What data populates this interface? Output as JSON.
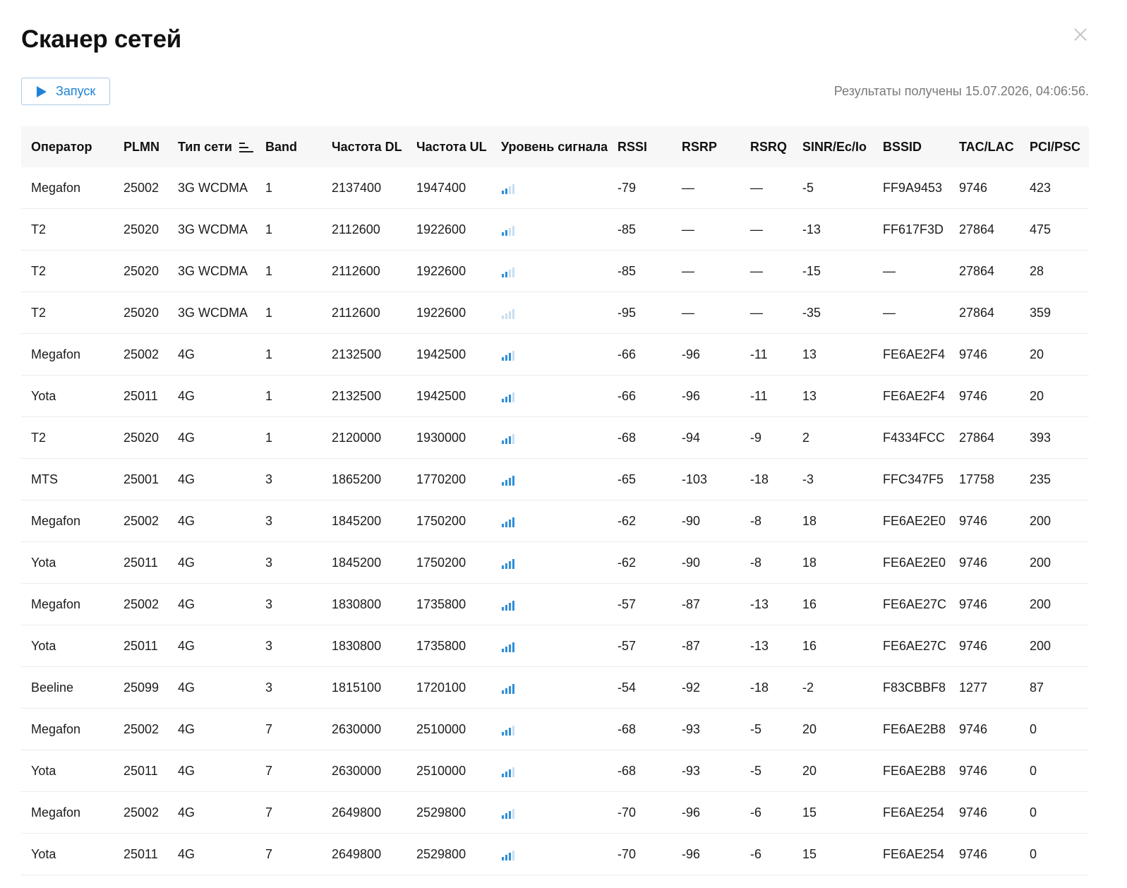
{
  "title": "Сканер сетей",
  "close_icon": "close-icon",
  "run_button": {
    "label": "Запуск",
    "icon": "play-icon"
  },
  "results_time": "Результаты получены 15.07.2026, 04:06:56.",
  "colors": {
    "accent": "#1f84d6",
    "signal_on": "#2f8fd8",
    "signal_off": "#c7def2",
    "border": "#ececec",
    "header_bg": "#f7f7f7"
  },
  "table": {
    "sort_icon": "sort-descending-icon",
    "columns": [
      "Оператор",
      "PLMN",
      "Тип сети",
      "Band",
      "Частота DL",
      "Частота UL",
      "Уровень сигнала",
      "RSSI",
      "RSRP",
      "RSRQ",
      "SINR/Ec/Io",
      "BSSID",
      "TAC/LAC",
      "PCI/PSC"
    ],
    "rows": [
      {
        "operator": "Megafon",
        "plmn": "25002",
        "type": "3G WCDMA",
        "band": "1",
        "dl": "2137400",
        "ul": "1947400",
        "signal": 2,
        "rssi": "-79",
        "rsrp": "—",
        "rsrq": "—",
        "sinr": "-5",
        "bssid": "FF9A9453",
        "tac": "9746",
        "pci": "423"
      },
      {
        "operator": "T2",
        "plmn": "25020",
        "type": "3G WCDMA",
        "band": "1",
        "dl": "2112600",
        "ul": "1922600",
        "signal": 2,
        "rssi": "-85",
        "rsrp": "—",
        "rsrq": "—",
        "sinr": "-13",
        "bssid": "FF617F3D",
        "tac": "27864",
        "pci": "475"
      },
      {
        "operator": "T2",
        "plmn": "25020",
        "type": "3G WCDMA",
        "band": "1",
        "dl": "2112600",
        "ul": "1922600",
        "signal": 2,
        "rssi": "-85",
        "rsrp": "—",
        "rsrq": "—",
        "sinr": "-15",
        "bssid": "—",
        "tac": "27864",
        "pci": "28"
      },
      {
        "operator": "T2",
        "plmn": "25020",
        "type": "3G WCDMA",
        "band": "1",
        "dl": "2112600",
        "ul": "1922600",
        "signal": 0,
        "rssi": "-95",
        "rsrp": "—",
        "rsrq": "—",
        "sinr": "-35",
        "bssid": "—",
        "tac": "27864",
        "pci": "359"
      },
      {
        "operator": "Megafon",
        "plmn": "25002",
        "type": "4G",
        "band": "1",
        "dl": "2132500",
        "ul": "1942500",
        "signal": 3,
        "rssi": "-66",
        "rsrp": "-96",
        "rsrq": "-11",
        "sinr": "13",
        "bssid": "FE6AE2F4",
        "tac": "9746",
        "pci": "20"
      },
      {
        "operator": "Yota",
        "plmn": "25011",
        "type": "4G",
        "band": "1",
        "dl": "2132500",
        "ul": "1942500",
        "signal": 3,
        "rssi": "-66",
        "rsrp": "-96",
        "rsrq": "-11",
        "sinr": "13",
        "bssid": "FE6AE2F4",
        "tac": "9746",
        "pci": "20"
      },
      {
        "operator": "T2",
        "plmn": "25020",
        "type": "4G",
        "band": "1",
        "dl": "2120000",
        "ul": "1930000",
        "signal": 3,
        "rssi": "-68",
        "rsrp": "-94",
        "rsrq": "-9",
        "sinr": "2",
        "bssid": "F4334FCC",
        "tac": "27864",
        "pci": "393"
      },
      {
        "operator": "MTS",
        "plmn": "25001",
        "type": "4G",
        "band": "3",
        "dl": "1865200",
        "ul": "1770200",
        "signal": 4,
        "rssi": "-65",
        "rsrp": "-103",
        "rsrq": "-18",
        "sinr": "-3",
        "bssid": "FFC347F5",
        "tac": "17758",
        "pci": "235"
      },
      {
        "operator": "Megafon",
        "plmn": "25002",
        "type": "4G",
        "band": "3",
        "dl": "1845200",
        "ul": "1750200",
        "signal": 4,
        "rssi": "-62",
        "rsrp": "-90",
        "rsrq": "-8",
        "sinr": "18",
        "bssid": "FE6AE2E0",
        "tac": "9746",
        "pci": "200"
      },
      {
        "operator": "Yota",
        "plmn": "25011",
        "type": "4G",
        "band": "3",
        "dl": "1845200",
        "ul": "1750200",
        "signal": 4,
        "rssi": "-62",
        "rsrp": "-90",
        "rsrq": "-8",
        "sinr": "18",
        "bssid": "FE6AE2E0",
        "tac": "9746",
        "pci": "200"
      },
      {
        "operator": "Megafon",
        "plmn": "25002",
        "type": "4G",
        "band": "3",
        "dl": "1830800",
        "ul": "1735800",
        "signal": 4,
        "rssi": "-57",
        "rsrp": "-87",
        "rsrq": "-13",
        "sinr": "16",
        "bssid": "FE6AE27C",
        "tac": "9746",
        "pci": "200"
      },
      {
        "operator": "Yota",
        "plmn": "25011",
        "type": "4G",
        "band": "3",
        "dl": "1830800",
        "ul": "1735800",
        "signal": 4,
        "rssi": "-57",
        "rsrp": "-87",
        "rsrq": "-13",
        "sinr": "16",
        "bssid": "FE6AE27C",
        "tac": "9746",
        "pci": "200"
      },
      {
        "operator": "Beeline",
        "plmn": "25099",
        "type": "4G",
        "band": "3",
        "dl": "1815100",
        "ul": "1720100",
        "signal": 4,
        "rssi": "-54",
        "rsrp": "-92",
        "rsrq": "-18",
        "sinr": "-2",
        "bssid": "F83CBBF8",
        "tac": "1277",
        "pci": "87"
      },
      {
        "operator": "Megafon",
        "plmn": "25002",
        "type": "4G",
        "band": "7",
        "dl": "2630000",
        "ul": "2510000",
        "signal": 3,
        "rssi": "-68",
        "rsrp": "-93",
        "rsrq": "-5",
        "sinr": "20",
        "bssid": "FE6AE2B8",
        "tac": "9746",
        "pci": "0"
      },
      {
        "operator": "Yota",
        "plmn": "25011",
        "type": "4G",
        "band": "7",
        "dl": "2630000",
        "ul": "2510000",
        "signal": 3,
        "rssi": "-68",
        "rsrp": "-93",
        "rsrq": "-5",
        "sinr": "20",
        "bssid": "FE6AE2B8",
        "tac": "9746",
        "pci": "0"
      },
      {
        "operator": "Megafon",
        "plmn": "25002",
        "type": "4G",
        "band": "7",
        "dl": "2649800",
        "ul": "2529800",
        "signal": 3,
        "rssi": "-70",
        "rsrp": "-96",
        "rsrq": "-6",
        "sinr": "15",
        "bssid": "FE6AE254",
        "tac": "9746",
        "pci": "0"
      },
      {
        "operator": "Yota",
        "plmn": "25011",
        "type": "4G",
        "band": "7",
        "dl": "2649800",
        "ul": "2529800",
        "signal": 3,
        "rssi": "-70",
        "rsrp": "-96",
        "rsrq": "-6",
        "sinr": "15",
        "bssid": "FE6AE254",
        "tac": "9746",
        "pci": "0"
      }
    ]
  }
}
